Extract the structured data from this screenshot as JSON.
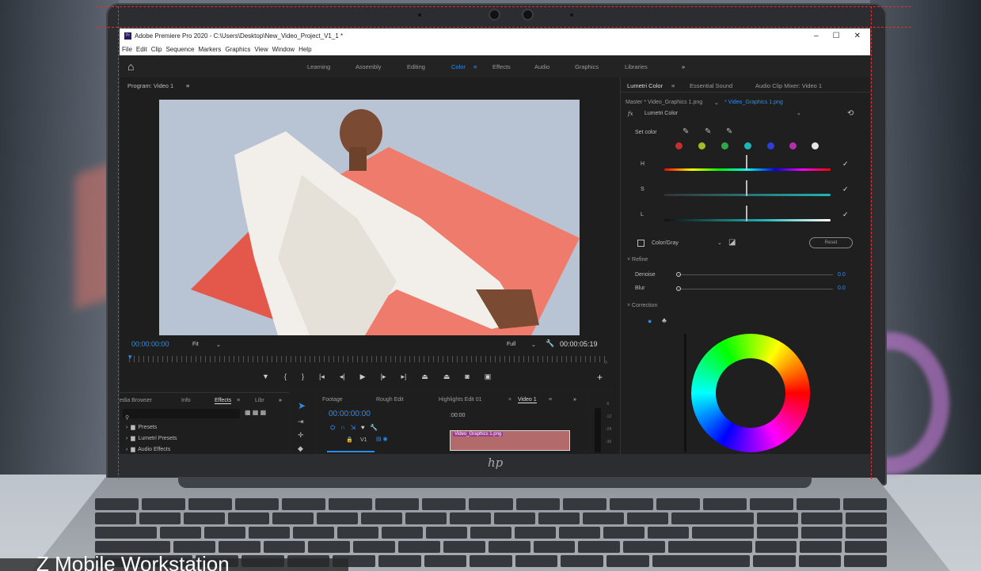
{
  "window": {
    "title": "Adobe Premiere Pro 2020 - C:\\Users\\Desktop\\New_Video_Project_V1_1 *",
    "app_icon": "Pr",
    "controls": [
      "–",
      "☐",
      "✕"
    ]
  },
  "menu": [
    "File",
    "Edit",
    "Clip",
    "Sequence",
    "Markers",
    "Graphics",
    "View",
    "Window",
    "Help"
  ],
  "workspaces": {
    "tabs": [
      "Learning",
      "Assembly",
      "Editing",
      "Color",
      "Effects",
      "Audio",
      "Graphics",
      "Libraries"
    ],
    "active": "Color",
    "active_menu": "≡",
    "more": "»"
  },
  "program": {
    "title": "Program: Video 1",
    "menu": "≡",
    "timecode_current": "00:00:00:00",
    "fit": "Fit",
    "quality": "Full",
    "timecode_duration": "00:00:05:19"
  },
  "effects_panel": {
    "tabs": [
      "edia Browser",
      "Info",
      "Effects",
      "Libr"
    ],
    "active": "Effects",
    "items": [
      "Presets",
      "Lumetri Presets",
      "Audio Effects"
    ]
  },
  "timeline": {
    "tabs": [
      "Footage",
      "Rough Edit",
      "Highlights Edit 01",
      "Video 1"
    ],
    "active": "Video 1",
    "timecode": "00:00:00:00",
    "ruler_start": ":00:00",
    "track": "V1",
    "clip": "Video_Graphics 1.png"
  },
  "meter": {
    "ticks": [
      "-6",
      "-12",
      "-24",
      "-36"
    ]
  },
  "lumetri": {
    "tabs": [
      "Lumetri Color",
      "Essential Sound",
      "Audio Clip Mixer: Video 1"
    ],
    "active": "Lumetri Color",
    "master": "Master * Video_Graphics 1.png",
    "clip_link": "* Video_Graphics 1.png",
    "fx": "fx",
    "effect": "Lumetri Color",
    "set_color": "Set color",
    "swatches": [
      "#c62d2d",
      "#a8b82a",
      "#2fa84a",
      "#1fb5b5",
      "#2d3fd6",
      "#b02fb0",
      "#e6e6e6"
    ],
    "hsl": [
      "H",
      "S",
      "L"
    ],
    "color_gray": "Color/Gray",
    "reset": "Reset",
    "refine": "Refine",
    "denoise": {
      "label": "Denoise",
      "value": "0.0"
    },
    "blur": {
      "label": "Blur",
      "value": "0.0"
    },
    "correction": "Correction"
  },
  "laptop": {
    "brand": "hp"
  },
  "caption": "Z Mobile Workstation"
}
